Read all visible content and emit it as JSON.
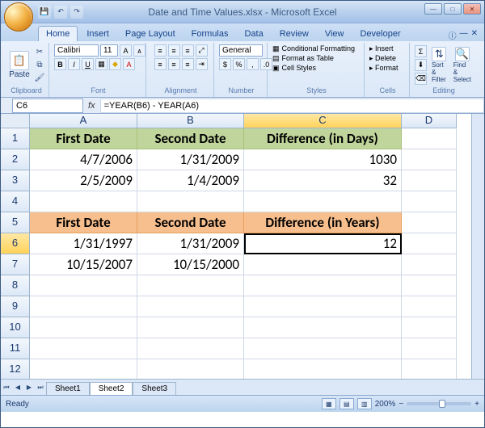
{
  "window": {
    "title": "Date and Time Values.xlsx - Microsoft Excel"
  },
  "ribbon_tabs": [
    "Home",
    "Insert",
    "Page Layout",
    "Formulas",
    "Data",
    "Review",
    "View",
    "Developer"
  ],
  "active_tab_index": 0,
  "clipboard": {
    "paste_label": "Paste",
    "group": "Clipboard"
  },
  "font": {
    "name": "Calibri",
    "size": "11",
    "group": "Font"
  },
  "alignment": {
    "group": "Alignment"
  },
  "number": {
    "format": "General",
    "group": "Number"
  },
  "styles": {
    "cond": "Conditional Formatting",
    "table": "Format as Table",
    "cell": "Cell Styles",
    "group": "Styles"
  },
  "cells": {
    "insert": "Insert",
    "delete": "Delete",
    "format": "Format",
    "group": "Cells"
  },
  "editing": {
    "sort": "Sort & Filter",
    "find": "Find & Select",
    "group": "Editing"
  },
  "name_box": "C6",
  "formula": "=YEAR(B6) - YEAR(A6)",
  "columns": [
    "A",
    "B",
    "C",
    "D"
  ],
  "rows": {
    "1": {
      "A": "First Date",
      "B": "Second Date",
      "C": "Difference (in Days)",
      "D": "",
      "class": "hdr-green"
    },
    "2": {
      "A": "4/7/2006",
      "B": "1/31/2009",
      "C": "1030",
      "D": ""
    },
    "3": {
      "A": "2/5/2009",
      "B": "1/4/2009",
      "C": "32",
      "D": ""
    },
    "4": {
      "A": "",
      "B": "",
      "C": "",
      "D": ""
    },
    "5": {
      "A": "First Date",
      "B": "Second Date",
      "C": "Difference (in Years)",
      "D": "",
      "class": "hdr-orange"
    },
    "6": {
      "A": "1/31/1997",
      "B": "1/31/2009",
      "C": "12",
      "D": ""
    },
    "7": {
      "A": "10/15/2007",
      "B": "10/15/2000",
      "C": "",
      "D": ""
    },
    "8": {
      "A": "",
      "B": "",
      "C": "",
      "D": ""
    },
    "9": {
      "A": "",
      "B": "",
      "C": "",
      "D": ""
    },
    "10": {
      "A": "",
      "B": "",
      "C": "",
      "D": ""
    },
    "11": {
      "A": "",
      "B": "",
      "C": "",
      "D": ""
    },
    "12": {
      "A": "",
      "B": "",
      "C": "",
      "D": ""
    }
  },
  "active_cell": "C6",
  "sheets": [
    "Sheet1",
    "Sheet2",
    "Sheet3"
  ],
  "active_sheet_index": 1,
  "status": {
    "ready": "Ready",
    "zoom": "200%"
  }
}
